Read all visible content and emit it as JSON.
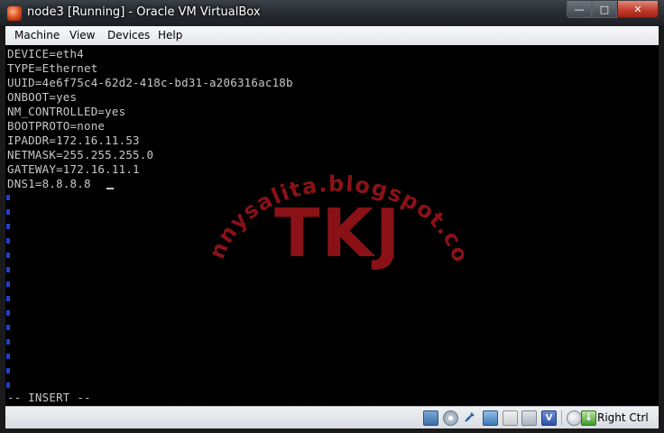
{
  "window": {
    "title": "node3 [Running] - Oracle VM VirtualBox",
    "controls": {
      "minimize": "—",
      "maximize": "□",
      "close": "✕"
    }
  },
  "menu": [
    "Machine",
    "View",
    "Devices",
    "Help"
  ],
  "console": {
    "lines": [
      "DEVICE=eth4",
      "TYPE=Ethernet",
      "UUID=4e6f75c4-62d2-418c-bd31-a206316ac18b",
      "ONBOOT=yes",
      "NM_CONTROLLED=yes",
      "BOOTPROTO=none",
      "IPADDR=172.16.11.53",
      "NETMASK=255.255.255.0",
      "GATEWAY=172.16.11.1",
      "DNS1=8.8.8.8"
    ],
    "mode_line": "-- INSERT --"
  },
  "watermark": {
    "url": "rennysalita.blogspot.com",
    "logo": "TKJ",
    "color": "#8a1216"
  },
  "statusbar": {
    "icons": [
      "hard-disk-icon",
      "optical-disc-icon",
      "usb-icon",
      "network-icon",
      "shared-folder-icon",
      "display-icon",
      "virtualization-icon",
      "mouse-integration-icon",
      "keyboard-capture-icon"
    ],
    "host_key": "Right Ctrl"
  }
}
